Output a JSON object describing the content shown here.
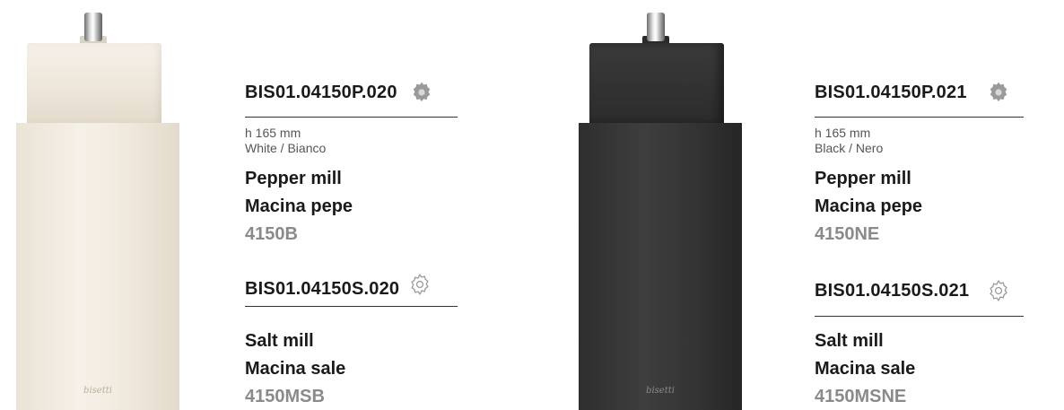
{
  "products": [
    {
      "variant": "white",
      "brand": "bisetti",
      "pepper": {
        "code": "BIS01.04150P.020",
        "height": "h 165 mm",
        "color": "White / Bianco",
        "name_en": "Pepper mill",
        "name_it": "Macina pepe",
        "ref": "4150B",
        "icon": "gear-solid-icon"
      },
      "salt": {
        "code": "BIS01.04150S.020",
        "name_en": "Salt mill",
        "name_it": "Macina sale",
        "ref": "4150MSB",
        "icon": "gear-outline-icon"
      }
    },
    {
      "variant": "black",
      "brand": "bisetti",
      "pepper": {
        "code": "BIS01.04150P.021",
        "height": "h 165 mm",
        "color": "Black / Nero",
        "name_en": "Pepper mill",
        "name_it": "Macina pepe",
        "ref": "4150NE",
        "icon": "gear-solid-icon"
      },
      "salt": {
        "code": "BIS01.04150S.021",
        "name_en": "Salt mill",
        "name_it": "Macina sale",
        "ref": "4150MSNE",
        "icon": "gear-outline-icon"
      }
    }
  ],
  "colors": {
    "text": "#1a1a1a",
    "ref_gray": "#8a8a8a",
    "icon_gray": "#9a9a9a"
  }
}
